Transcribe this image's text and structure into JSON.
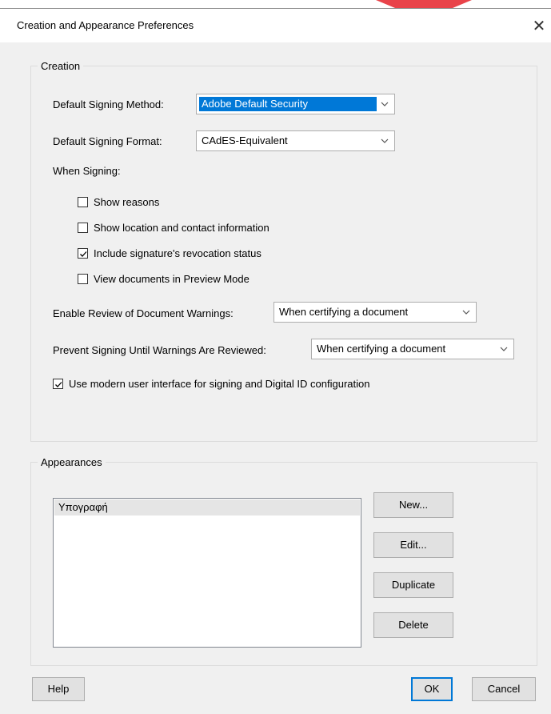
{
  "window": {
    "title": "Creation and Appearance Preferences",
    "close_glyph": "✕"
  },
  "creation": {
    "legend": "Creation",
    "default_signing_method": {
      "label": "Default Signing Method:",
      "value": "Adobe Default Security"
    },
    "default_signing_format": {
      "label": "Default Signing Format:",
      "value": "CAdES-Equivalent"
    },
    "when_signing_label": "When Signing:",
    "options": [
      {
        "label": "Show reasons",
        "checked": false
      },
      {
        "label": "Show location and contact information",
        "checked": false
      },
      {
        "label": "Include signature's revocation status",
        "checked": true
      },
      {
        "label": "View documents in Preview Mode",
        "checked": false
      }
    ],
    "enable_review": {
      "label": "Enable Review of Document Warnings:",
      "value": "When certifying a document"
    },
    "prevent_signing": {
      "label": "Prevent Signing Until Warnings Are Reviewed:",
      "value": "When certifying a document"
    },
    "modern_ui": {
      "label": "Use modern user interface for signing and Digital ID configuration",
      "checked": true
    }
  },
  "appearances": {
    "legend": "Appearances",
    "items": [
      "Υπογραφή"
    ],
    "buttons": {
      "new": "New...",
      "edit": "Edit...",
      "duplicate": "Duplicate",
      "delete": "Delete"
    }
  },
  "footer": {
    "help": "Help",
    "ok": "OK",
    "cancel": "Cancel"
  },
  "colors": {
    "accent_red": "#e5222a",
    "selection_blue": "#0078d7",
    "dialog_bg": "#f0f0f0"
  }
}
